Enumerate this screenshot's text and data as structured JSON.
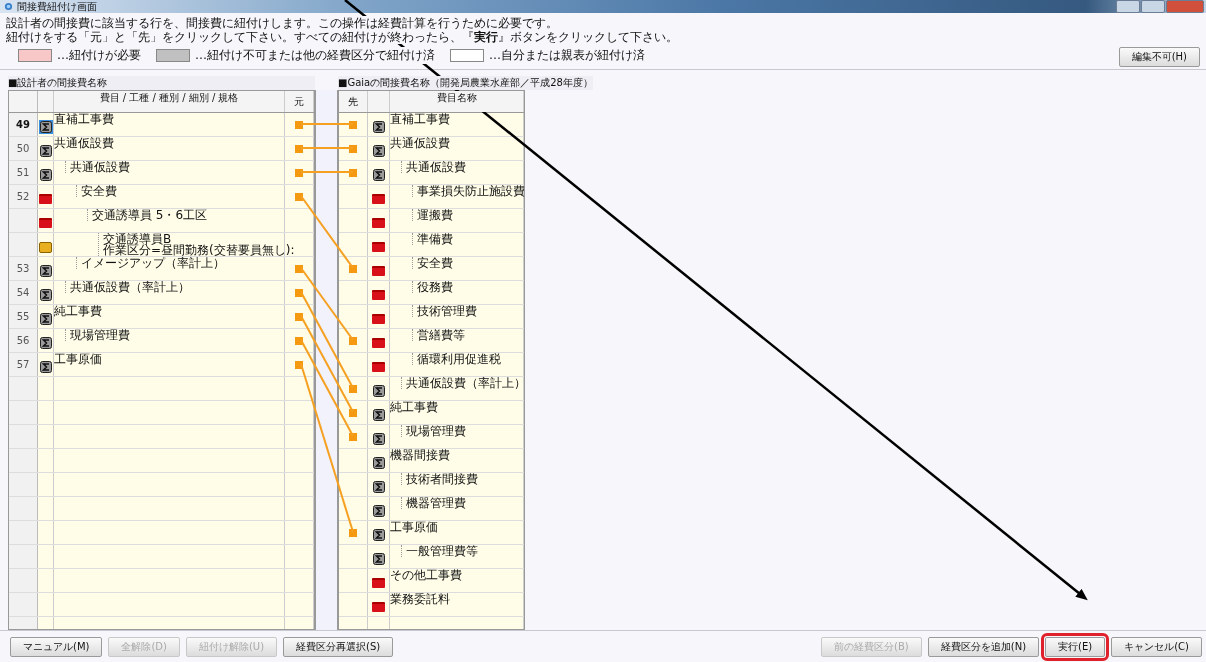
{
  "window": {
    "title": "間接費紐付け画面"
  },
  "instructions": [
    "設計者の間接費に該当する行を、間接費に紐付けします。この操作は経費計算を行うために必要です。",
    "紐付けをする「元」と「先」をクリックして下さい。すべての紐付けが終わったら、『**実行**』ボタンをクリックして下さい。"
  ],
  "legend": [
    {
      "color": "#f8c8c8",
      "label": "…紐付けが必要"
    },
    {
      "color": "#c0c0c0",
      "label": "…紐付け不可または他の経費区分で紐付け済"
    },
    {
      "color": "#ffffff",
      "label": "…自分または親表が紐付け済"
    }
  ],
  "edit_button": {
    "label": "編集不可(H)",
    "disabled": false
  },
  "left_table": {
    "heading": "■設計者の間接費名称",
    "columns": [
      "費目 / 工種 / 種別 / 細別 / 規格",
      "元"
    ],
    "rows": [
      {
        "number": "49",
        "kind": "sum",
        "name": "直補工事費",
        "linked": true,
        "selected": true
      },
      {
        "number": "50",
        "kind": "sum",
        "name": "共通仮設費",
        "linked": true,
        "selected": false,
        "children": [
          {
            "number": "51",
            "kind": "sum",
            "name": "共通仮設費",
            "linked": true,
            "selected": false,
            "children": [
              {
                "number": "52",
                "kind": "folder",
                "name": "安全費",
                "linked": true,
                "selected": false,
                "children": [
                  {
                    "kind": "folder",
                    "name": "交通誘導員 5・6工区",
                    "linked": false,
                    "selected": false,
                    "children": [
                      {
                        "kind": "note",
                        "name": "交通誘導員B\n作業区分=昼間勤務(交替要員無し):",
                        "linked": false,
                        "selected": false
                      }
                    ]
                  }
                ]
              },
              {
                "number": "53",
                "kind": "sum",
                "name": "イメージアップ（率計上）",
                "linked": true,
                "selected": false
              }
            ]
          },
          {
            "number": "54",
            "kind": "sum",
            "name": "共通仮設費（率計上）",
            "linked": true,
            "selected": false
          }
        ]
      },
      {
        "number": "55",
        "kind": "sum",
        "name": "純工事費",
        "linked": true,
        "selected": false,
        "children": [
          {
            "number": "56",
            "kind": "sum",
            "name": "現場管理費",
            "linked": true,
            "selected": false
          }
        ]
      },
      {
        "number": "57",
        "kind": "sum",
        "name": "工事原価",
        "linked": true,
        "selected": false
      }
    ]
  },
  "right_table": {
    "heading": "■Gaiaの間接費名称（開発局農業水産部／平成28年度）",
    "columns": [
      "先",
      "費目名称"
    ],
    "rows": [
      {
        "kind": "sum",
        "name": "直補工事費",
        "linked": true
      },
      {
        "kind": "sum",
        "name": "共通仮設費",
        "linked": true,
        "children": [
          {
            "kind": "sum",
            "name": "共通仮設費",
            "linked": true,
            "children": [
              {
                "kind": "folder",
                "name": "事業損失防止施設費",
                "linked": false
              },
              {
                "kind": "folder",
                "name": "運搬費",
                "linked": false
              },
              {
                "kind": "folder",
                "name": "準備費",
                "linked": false
              },
              {
                "kind": "folder",
                "name": "安全費",
                "linked": true
              },
              {
                "kind": "folder",
                "name": "役務費",
                "linked": false
              },
              {
                "kind": "folder",
                "name": "技術管理費",
                "linked": false
              },
              {
                "kind": "folder",
                "name": "営繕費等",
                "linked": true
              },
              {
                "kind": "folder",
                "name": "循環利用促進税",
                "linked": false
              }
            ]
          },
          {
            "kind": "sum",
            "name": "共通仮設費（率計上）",
            "linked": true
          }
        ]
      },
      {
        "kind": "sum",
        "name": "純工事費",
        "linked": true,
        "children": [
          {
            "kind": "sum",
            "name": "現場管理費",
            "linked": true
          }
        ]
      },
      {
        "kind": "sum",
        "name": "機器間接費",
        "linked": false,
        "children": [
          {
            "kind": "sum",
            "name": "技術者間接費",
            "linked": false
          },
          {
            "kind": "sum",
            "name": "機器管理費",
            "linked": false
          }
        ]
      },
      {
        "kind": "sum",
        "name": "工事原価",
        "linked": true,
        "children": [
          {
            "kind": "sum",
            "name": "一般管理費等",
            "linked": false
          }
        ]
      },
      {
        "kind": "folder",
        "name": "その他工事費",
        "linked": false
      },
      {
        "kind": "folder",
        "name": "業務委託料",
        "linked": false
      }
    ]
  },
  "bottom_left_buttons": [
    {
      "label": "マニュアル(M)",
      "disabled": false,
      "highlighted": false
    },
    {
      "label": "全解除(D)",
      "disabled": true,
      "highlighted": false
    },
    {
      "label": "紐付け解除(U)",
      "disabled": true,
      "highlighted": false
    },
    {
      "label": "経費区分再選択(S)",
      "disabled": false,
      "highlighted": false
    }
  ],
  "bottom_right_buttons": [
    {
      "label": "前の経費区分(B)",
      "disabled": true,
      "highlighted": false
    },
    {
      "label": "経費区分を追加(N)",
      "disabled": false,
      "highlighted": false
    },
    {
      "label": "実行(E)",
      "disabled": false,
      "highlighted": true
    },
    {
      "label": "キャンセル(C)",
      "disabled": false,
      "highlighted": false
    }
  ]
}
